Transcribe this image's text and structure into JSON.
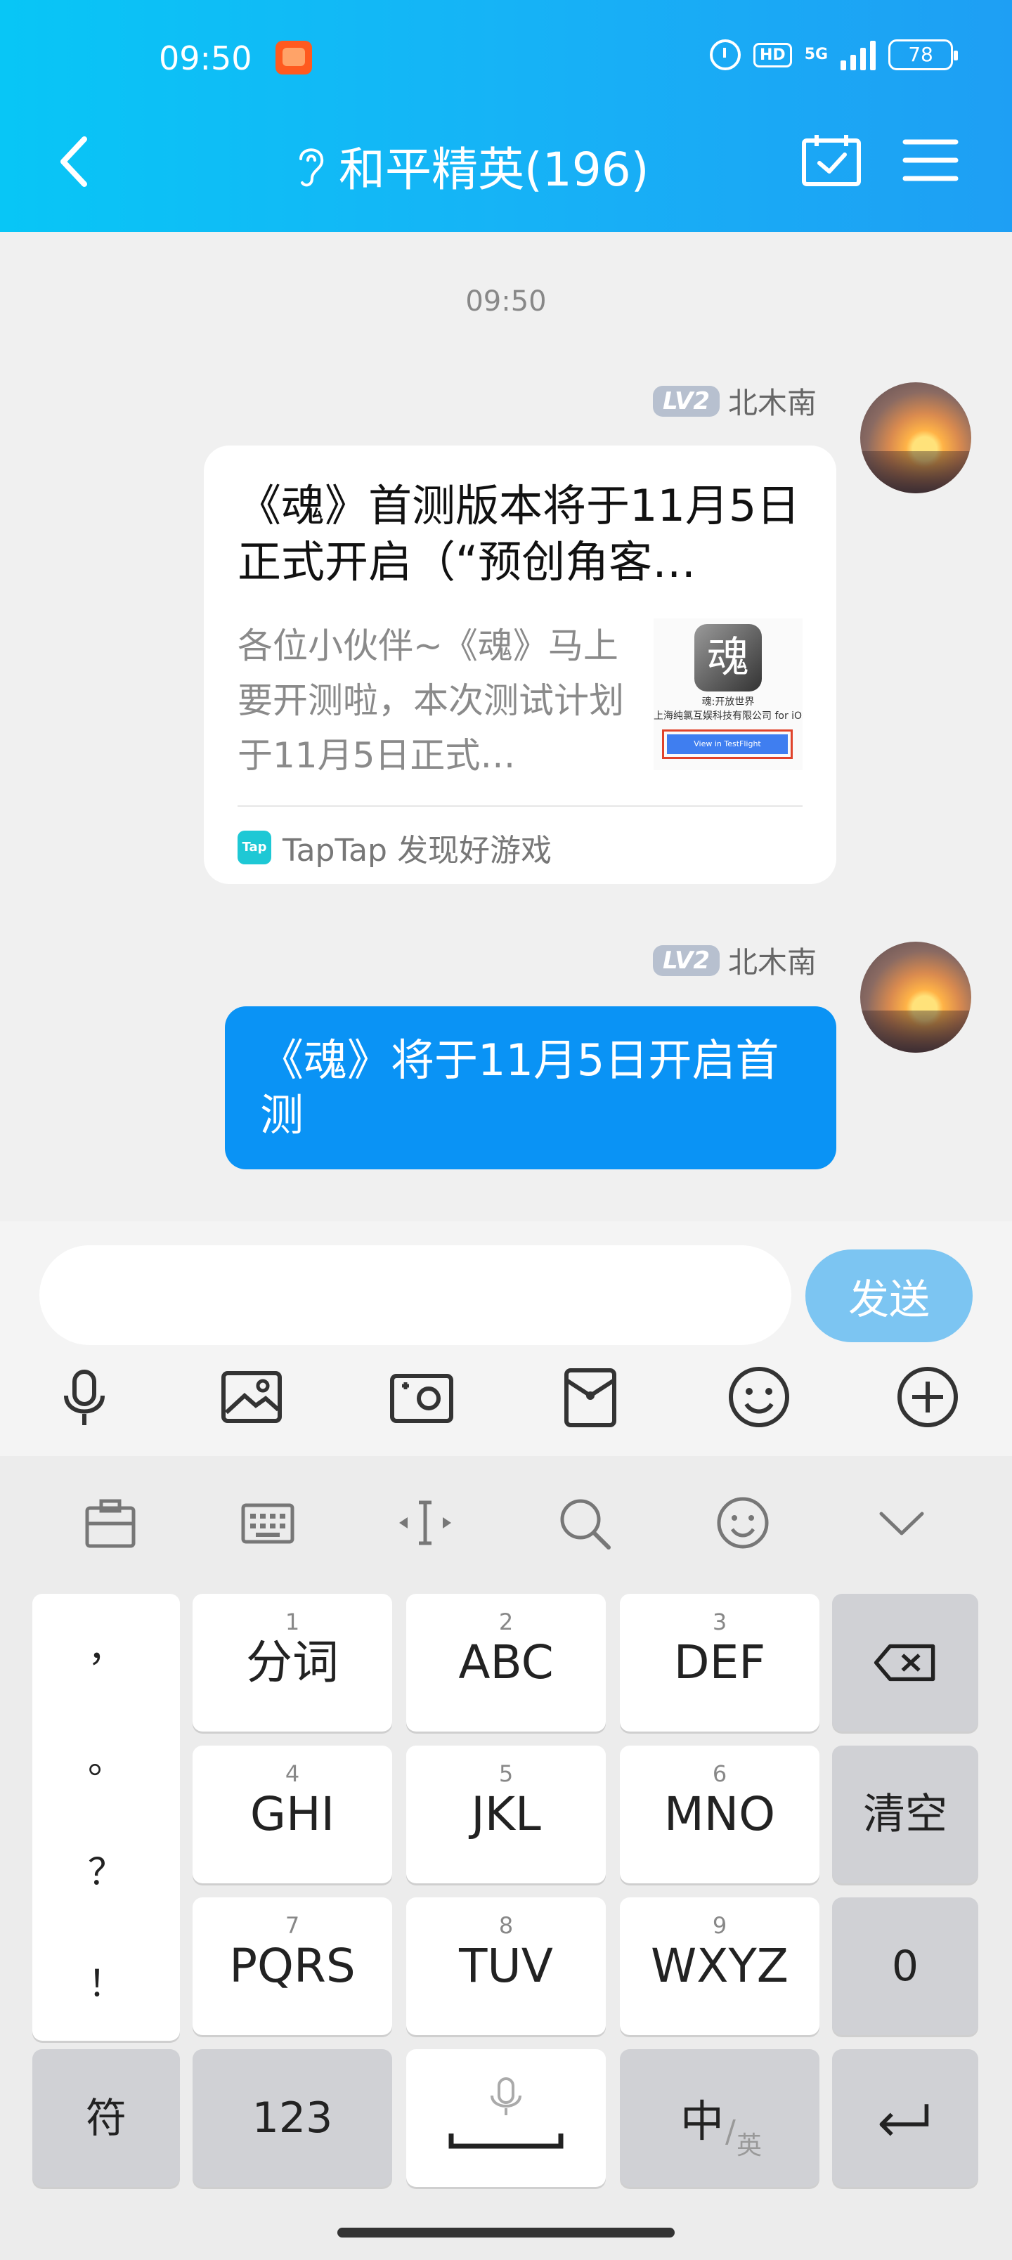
{
  "status_bar": {
    "time": "09:50",
    "hd": "HD",
    "network": "5G",
    "battery": "78"
  },
  "header": {
    "title": "和平精英(196)"
  },
  "chat": {
    "timestamp": "09:50",
    "messages": [
      {
        "sender_level": "LV2",
        "sender_name": "北木南",
        "card": {
          "title": "《魂》首测版本将于11月5日正式开启（“预创角客…",
          "body": "各位小伙伴~《魂》马上要开测啦，本次测试计划于11月5日正式…",
          "thumbnail": {
            "logo_char": "魂",
            "name": "魂:开放世界",
            "company": "上海纯氯互娱科技有限公司 for iOS",
            "button": "View in TestFlight"
          },
          "source": "TapTap 发现好游戏",
          "source_icon_text": "Tap"
        }
      },
      {
        "sender_level": "LV2",
        "sender_name": "北木南",
        "text": "《魂》将于11月5日开启首测"
      }
    ]
  },
  "composer": {
    "input_value": "",
    "send_label": "发送",
    "tools": [
      "microphone-icon",
      "image-icon",
      "camera-icon",
      "red-packet-icon",
      "emoji-icon",
      "plus-icon"
    ]
  },
  "keyboard": {
    "toolbar": [
      "clipboard-icon",
      "keyboard-icon",
      "cursor-icon",
      "search-icon",
      "emoji-icon",
      "collapse-icon"
    ],
    "punctuation": [
      "，",
      "。",
      "？",
      "！"
    ],
    "rows": [
      [
        {
          "num": "1",
          "label": "分词"
        },
        {
          "num": "2",
          "label": "ABC"
        },
        {
          "num": "3",
          "label": "DEF"
        }
      ],
      [
        {
          "num": "4",
          "label": "GHI"
        },
        {
          "num": "5",
          "label": "JKL"
        },
        {
          "num": "6",
          "label": "MNO"
        }
      ],
      [
        {
          "num": "7",
          "label": "PQRS"
        },
        {
          "num": "8",
          "label": "TUV"
        },
        {
          "num": "9",
          "label": "WXYZ"
        }
      ]
    ],
    "clear_label": "清空",
    "zero_label": "0",
    "symbol_label": "符",
    "numeric_label": "123",
    "lang_main": "中",
    "lang_sub": "英"
  }
}
